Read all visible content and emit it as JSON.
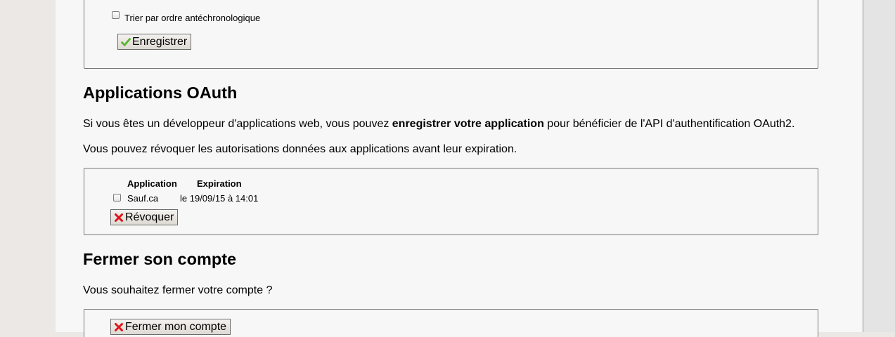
{
  "settings": {
    "reverse_chrono_label": "Trier par ordre antéchronologique",
    "save_button": "Enregistrer"
  },
  "oauth": {
    "title": "Applications OAuth",
    "intro_before": "Si vous êtes un développeur d'applications web, vous pouvez ",
    "intro_bold": "enregistrer votre application",
    "intro_after": " pour bénéficier de l'API d'authentification OAuth2.",
    "revoke_text": "Vous pouvez révoquer les autorisations données aux applications avant leur expiration.",
    "table": {
      "headers": [
        "Application",
        "Expiration"
      ],
      "rows": [
        {
          "application": "Sauf.ca",
          "expiration": "le 19/09/15 à 14:01"
        }
      ]
    },
    "revoke_button": "Révoquer"
  },
  "close_account": {
    "title": "Fermer son compte",
    "question": "Vous souhaitez fermer votre compte ?",
    "button": "Fermer mon compte"
  },
  "colors": {
    "check_green": "#5bb531",
    "cross_red": "#e0141a"
  }
}
